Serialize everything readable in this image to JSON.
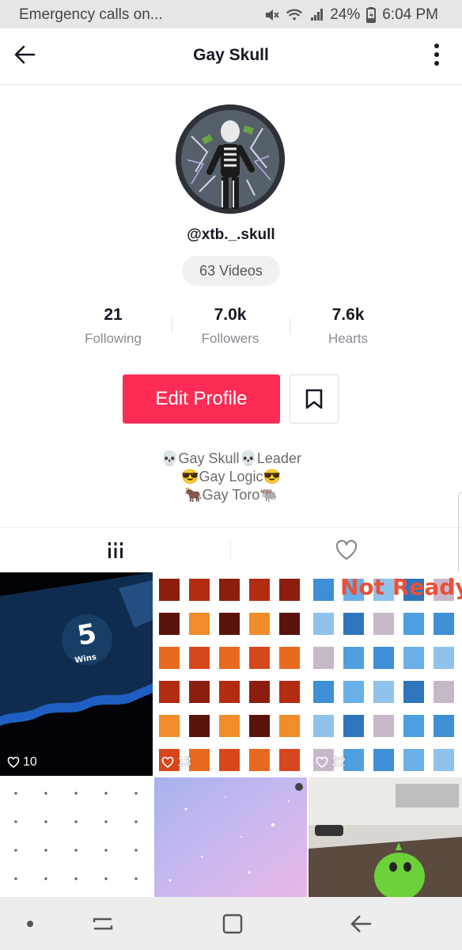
{
  "status_bar": {
    "carrier_text": "Emergency calls on...",
    "battery": "24%",
    "time": "6:04 PM",
    "icons": [
      "mute-icon",
      "wifi-icon",
      "signal-icon",
      "battery-icon"
    ]
  },
  "header": {
    "title": "Gay Skull",
    "back_icon": "arrow-left-icon",
    "more_icon": "more-vertical-icon"
  },
  "profile": {
    "username": "@xtb._.skull",
    "videos_count": "63 Videos",
    "stats": [
      {
        "value": "21",
        "label": "Following"
      },
      {
        "value": "7.0k",
        "label": "Followers"
      },
      {
        "value": "7.6k",
        "label": "Hearts"
      }
    ],
    "edit_button_label": "Edit Profile",
    "bio": {
      "line1": "💀Gay Skull💀Leader",
      "line2": "😎Gay Logic😎",
      "line3": "🐂Gay Toro🐃"
    }
  },
  "tabs": [
    {
      "name": "videos-tab",
      "icon": "grid-icon",
      "active": true
    },
    {
      "name": "liked-tab",
      "icon": "heart-outline-icon",
      "active": false
    }
  ],
  "videos": [
    {
      "likes": "10"
    },
    {
      "likes": "13"
    },
    {
      "likes": "22"
    },
    {
      "likes": ""
    },
    {
      "likes": ""
    },
    {
      "likes": ""
    }
  ],
  "tile_text": {
    "wins_number": "5",
    "wins_label": "Wins",
    "not_ready": "Not Ready"
  },
  "colors": {
    "accent": "#fe2c55",
    "text_primary": "#161823",
    "text_secondary": "#8a8b91"
  },
  "nav_bar": {
    "icons": [
      "dot-icon",
      "recent-apps-icon",
      "home-icon",
      "back-icon"
    ]
  }
}
